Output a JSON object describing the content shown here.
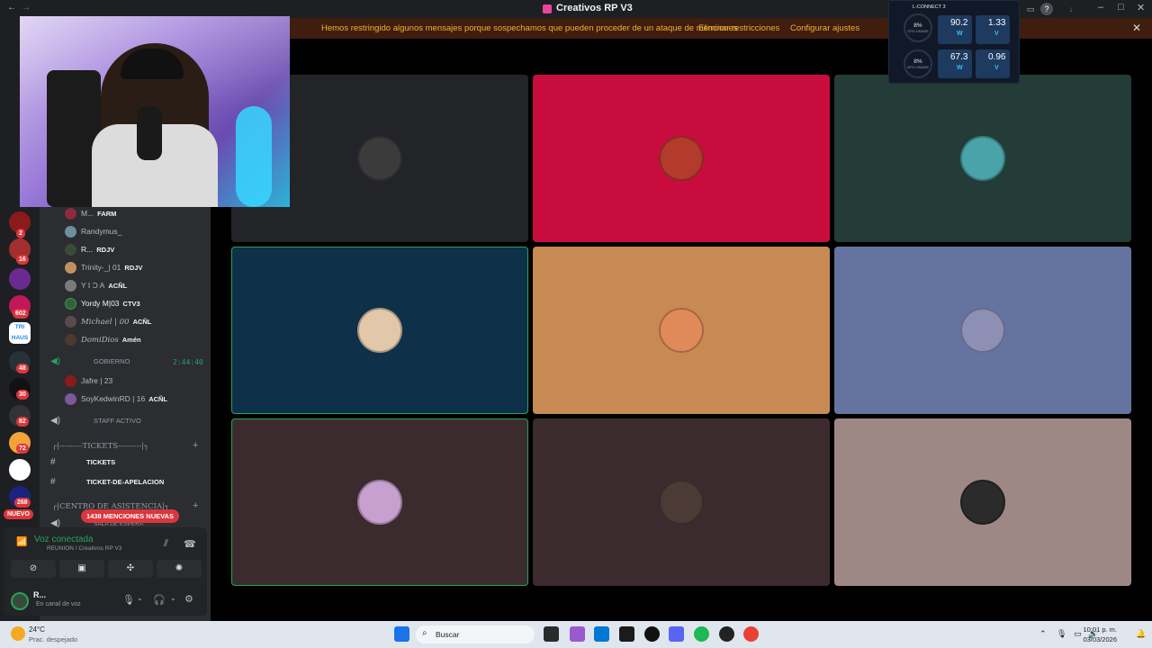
{
  "window": {
    "title": "Creativos RP V3"
  },
  "notice": {
    "message": "Hemos restringido algunos mensajes porque sospechamos que pueden proceder de un ataque de menciones",
    "action_remove": "Eliminar restricciones",
    "action_configure": "Configurar ajustes"
  },
  "server_rail": {
    "badges": [
      "2",
      "16",
      "602",
      "48",
      "30",
      "82",
      "72",
      "268"
    ],
    "new_label": "NUEVO",
    "trihaus_label": "TRI HAUS"
  },
  "sidebar": {
    "members_top": [
      {
        "name": "M...",
        "tag": "FARM"
      },
      {
        "name": "Randymus_",
        "tag": ""
      },
      {
        "name": "R...",
        "tag": "RDJV"
      },
      {
        "name": "Trinity-_| 01",
        "tag": "RDJV"
      },
      {
        "name": "Y I Ɔ A",
        "tag": "ACÑL"
      },
      {
        "name": "Yordy M|03",
        "tag": "CTV3"
      },
      {
        "name": "Michael | 00",
        "tag": "ACÑL"
      },
      {
        "name": "DomiDios",
        "tag": "Amén"
      }
    ],
    "gobierno": {
      "label": "GOBIERNO",
      "timer": "2:44:40"
    },
    "gobierno_members": [
      {
        "name": "Jafre | 23",
        "tag": ""
      },
      {
        "name": "SoyKedwinRD | 16",
        "tag": "ACÑL"
      }
    ],
    "staff": {
      "label": "STAFF ACTIVO"
    },
    "category_tickets": "┌|---------TICKETS---------|┐",
    "channel_tickets": "TICKETS",
    "channel_apelacion": "TICKET-DE-APELACION",
    "category_asistencia": "┌|CENTRO DE ASISTENCIA|┐",
    "channel_espera": "SALA DE ESPERA",
    "mentions_badge": "1438 MENCIONES NUEVAS"
  },
  "voice": {
    "status": "Voz conectada",
    "channel": "REUNION / Creativos RP V3",
    "user_name": "R...",
    "user_status": "En canal de voz"
  },
  "stage": {
    "tiles": [
      {
        "color": "#232428",
        "pfp": "#3b3b3b",
        "speaking": false
      },
      {
        "color": "#c90c3e",
        "pfp": "#b33b2c",
        "speaking": false
      },
      {
        "color": "#233c37",
        "pfp": "#4aa3a8",
        "speaking": false
      },
      {
        "color": "#0f3049",
        "pfp": "#e2c8a8",
        "speaking": true
      },
      {
        "color": "#c68a52",
        "pfp": "#e08a5a",
        "speaking": false
      },
      {
        "color": "#6573a0",
        "pfp": "#8e8fb5",
        "speaking": false
      },
      {
        "color": "#3b2b2f",
        "pfp": "#c7a0cf",
        "speaking": true
      },
      {
        "color": "#3b2b2f",
        "pfp": "#4b3a36",
        "speaking": false
      },
      {
        "color": "#9e8886",
        "pfp": "#2b2b2b",
        "speaking": false
      }
    ]
  },
  "monitor": {
    "title": "L-CONNECT 3",
    "cpu_pct": "8%",
    "cpu_label": "CPU USAGE",
    "gpu_pct": "8%",
    "gpu_label": "GPU USAGE",
    "cpu_power": "90.2",
    "cpu_power_unit": "W",
    "cpu_volt": "1.33",
    "cpu_volt_unit": "V",
    "gpu_power": "67.3",
    "gpu_power_unit": "W",
    "gpu_volt": "0.96",
    "gpu_volt_unit": "V"
  },
  "taskbar": {
    "temp": "24°C",
    "condition": "Prac. despejado",
    "search_placeholder": "Buscar",
    "time": "10:01 p. m.",
    "date": "03/03/2026"
  }
}
